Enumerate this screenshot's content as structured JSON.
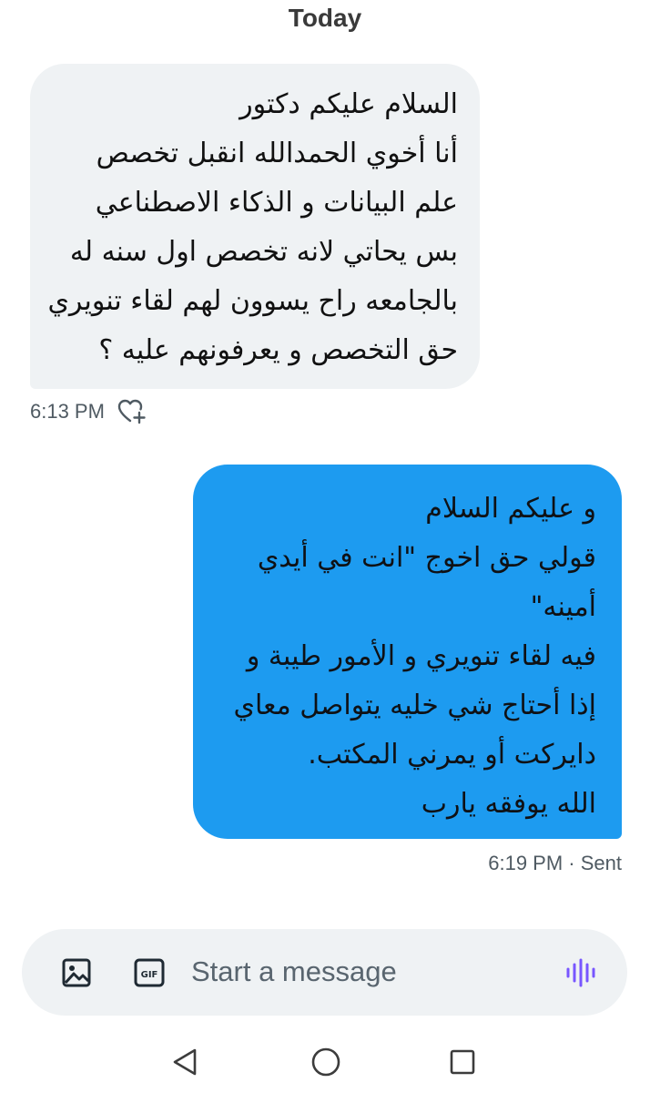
{
  "conversation": {
    "day_label": "Today"
  },
  "messages": [
    {
      "direction": "incoming",
      "lines": [
        "السلام عليكم دكتور",
        "أنا أخوي الحمدالله انقبل تخصص",
        "علم البيانات و الذكاء الاصطناعي",
        "بس يحاتي لانه تخصص اول سنه له",
        "بالجامعه راح يسوون لهم لقاء تنويري",
        "حق التخصص و يعرفونهم عليه ؟"
      ],
      "time": "6:13 PM",
      "reaction_icon": "heart-plus-icon"
    },
    {
      "direction": "outgoing",
      "lines": [
        "و عليكم السلام",
        "قولي حق اخوج \"انت في أيدي",
        "أمينه\"",
        "فيه لقاء تنويري و الأمور طيبة و",
        "إذا أحتاج شي خليه يتواصل معاي",
        "دايركت أو يمرني المكتب.",
        "الله يوفقه يارب"
      ],
      "status": "6:19 PM · Sent"
    }
  ],
  "composer": {
    "placeholder": "Start a message",
    "image_icon": "image-icon",
    "gif_icon": "gif-icon",
    "gif_label": "GIF",
    "voice_icon": "voice-waveform-icon"
  },
  "system_nav": {
    "back_icon": "back-triangle-icon",
    "home_icon": "home-circle-icon",
    "recents_icon": "recents-square-icon"
  },
  "colors": {
    "incoming_bubble": "#eff2f4",
    "outgoing_bubble": "#1d9bf0",
    "voice_accent": "#7856ff",
    "meta_text": "#4f5a62"
  }
}
